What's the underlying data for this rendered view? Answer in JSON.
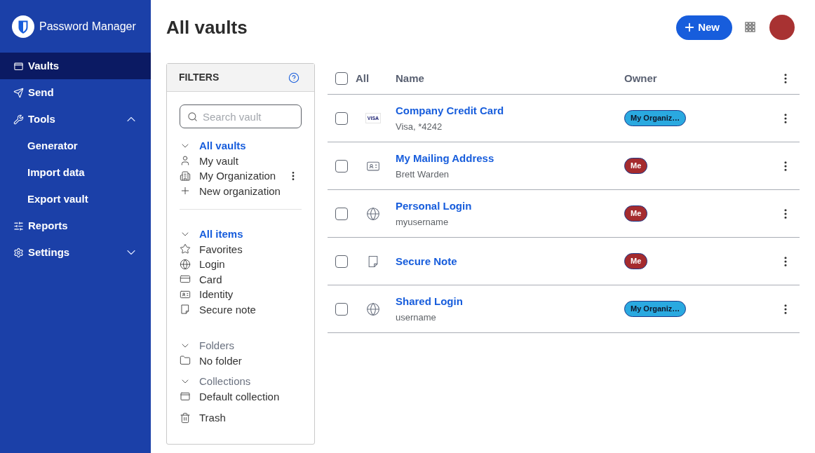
{
  "sidebar": {
    "product_name": "Password Manager",
    "items": [
      {
        "label": "Vaults",
        "kind": "vaults",
        "selected": true
      },
      {
        "label": "Send",
        "kind": "send",
        "selected": false
      },
      {
        "label": "Tools",
        "kind": "tools",
        "selected": false,
        "expanded": true,
        "children": [
          {
            "label": "Generator",
            "selected": false
          },
          {
            "label": "Import data",
            "selected": false
          },
          {
            "label": "Export vault",
            "selected": false
          }
        ]
      },
      {
        "label": "Reports",
        "kind": "reports",
        "selected": false
      },
      {
        "label": "Settings",
        "kind": "settings",
        "selected": false,
        "expanded": false
      }
    ]
  },
  "header": {
    "title": "All vaults",
    "new_button": "New"
  },
  "filters": {
    "title": "FILTERS",
    "search": {
      "placeholder": "Search vault"
    },
    "sections": [
      {
        "kind": "vaults",
        "header": {
          "label": "All vaults",
          "selected": true,
          "expanded": true
        },
        "items": [
          {
            "label": "My vault",
            "kind": "person",
            "selected": false,
            "has_menu": false
          },
          {
            "label": "My Organization",
            "kind": "organization",
            "selected": false,
            "has_menu": true
          },
          {
            "label": "New organization",
            "kind": "add",
            "selected": false,
            "has_menu": false
          }
        ]
      },
      {
        "kind": "types",
        "header": {
          "label": "All items",
          "selected": true,
          "expanded": true
        },
        "items": [
          {
            "label": "Favorites",
            "kind": "favorites",
            "selected": false
          },
          {
            "label": "Login",
            "kind": "login",
            "selected": false
          },
          {
            "label": "Card",
            "kind": "card",
            "selected": false
          },
          {
            "label": "Identity",
            "kind": "identity",
            "selected": false
          },
          {
            "label": "Secure note",
            "kind": "note",
            "selected": false
          }
        ]
      },
      {
        "kind": "folders",
        "header": {
          "label": "Folders",
          "selected": false,
          "expanded": true
        },
        "items": [
          {
            "label": "No folder",
            "kind": "folder",
            "selected": false
          }
        ]
      },
      {
        "kind": "collections",
        "header": {
          "label": "Collections",
          "selected": false,
          "expanded": true
        },
        "items": [
          {
            "label": "Default collection",
            "kind": "collection",
            "selected": false
          }
        ]
      },
      {
        "kind": "trash",
        "items": [
          {
            "label": "Trash",
            "kind": "trash",
            "selected": false
          }
        ]
      }
    ]
  },
  "table": {
    "select_all": {
      "label": "All",
      "checked": false
    },
    "columns": [
      "Name",
      "Owner"
    ],
    "rows": [
      {
        "kind": "card",
        "brand": "VISA",
        "name": "Company Credit Card",
        "subtitle": "Visa, *4242",
        "owner": {
          "label": "My Organiz…",
          "color": "#2aa9e0"
        },
        "checked": false
      },
      {
        "kind": "identity",
        "name": "My Mailing Address",
        "subtitle": "Brett Warden",
        "owner": {
          "label": "Me",
          "color": "#a52b2e"
        },
        "checked": false
      },
      {
        "kind": "login",
        "name": "Personal Login",
        "subtitle": "myusername",
        "owner": {
          "label": "Me",
          "color": "#a52b2e"
        },
        "checked": false
      },
      {
        "kind": "note",
        "name": "Secure Note",
        "owner": {
          "label": "Me",
          "color": "#a52b2e"
        },
        "checked": false
      },
      {
        "kind": "login",
        "name": "Shared Login",
        "subtitle": "username",
        "owner": {
          "label": "My Organiz…",
          "color": "#2aa9e0"
        },
        "checked": false
      }
    ]
  }
}
